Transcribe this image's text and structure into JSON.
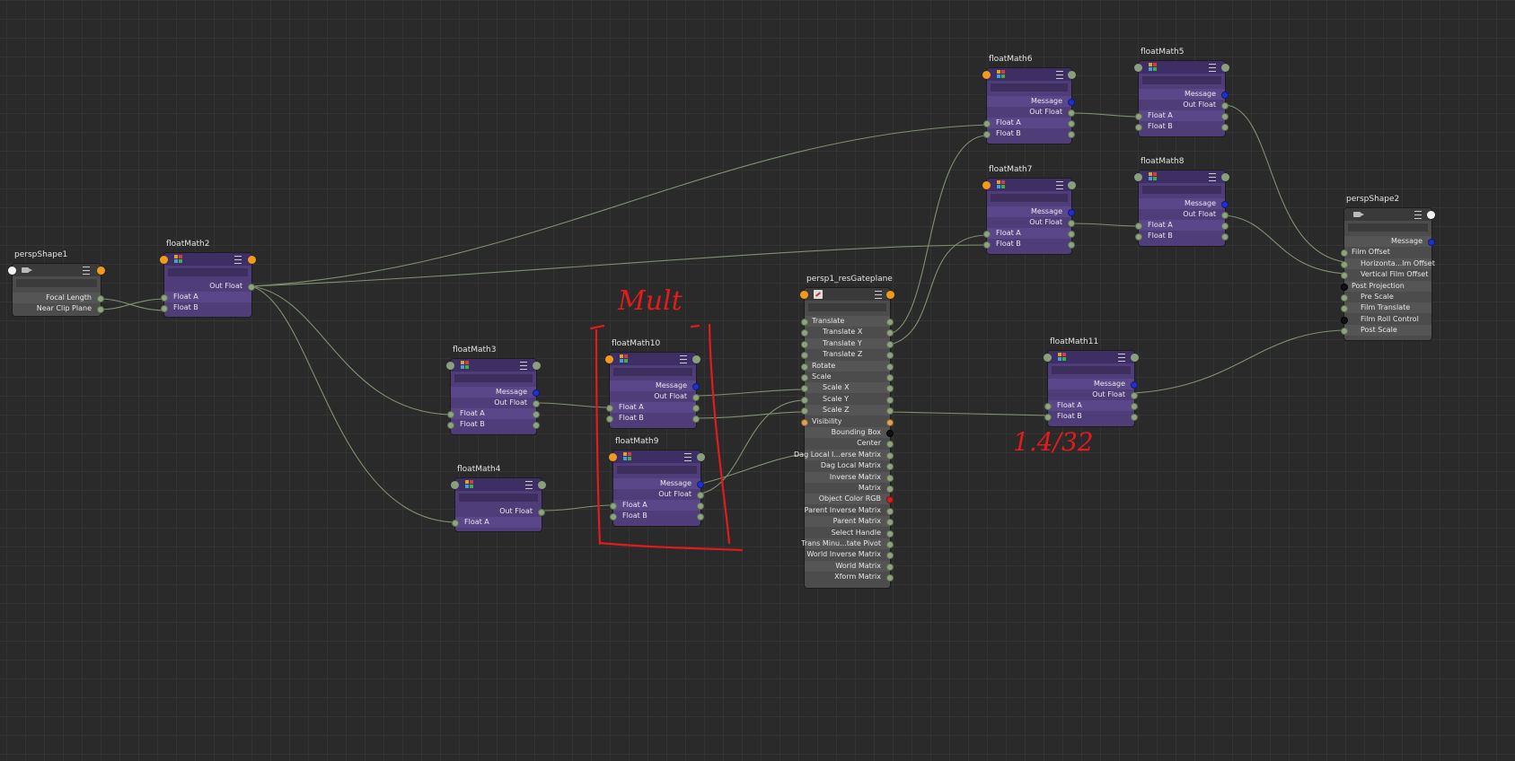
{
  "nodes": {
    "perspShape1": {
      "title": "perspShape1",
      "rows": [
        "Focal Length",
        "Near Clip Plane"
      ]
    },
    "floatMath2": {
      "title": "floatMath2",
      "out": "Out Float",
      "inA": "Float A",
      "inB": "Float B"
    },
    "floatMath3": {
      "title": "floatMath3",
      "msg": "Message",
      "out": "Out Float",
      "inA": "Float A",
      "inB": "Float B"
    },
    "floatMath4": {
      "title": "floatMath4",
      "out": "Out Float",
      "inA": "Float A"
    },
    "floatMath10": {
      "title": "floatMath10",
      "msg": "Message",
      "out": "Out Float",
      "inA": "Float A",
      "inB": "Float B"
    },
    "floatMath9": {
      "title": "floatMath9",
      "msg": "Message",
      "out": "Out Float",
      "inA": "Float A",
      "inB": "Float B"
    },
    "floatMath6": {
      "title": "floatMath6",
      "msg": "Message",
      "out": "Out Float",
      "inA": "Float A",
      "inB": "Float B"
    },
    "floatMath5": {
      "title": "floatMath5",
      "msg": "Message",
      "out": "Out Float",
      "inA": "Float A",
      "inB": "Float B"
    },
    "floatMath7": {
      "title": "floatMath7",
      "msg": "Message",
      "out": "Out Float",
      "inA": "Float A",
      "inB": "Float B"
    },
    "floatMath8": {
      "title": "floatMath8",
      "msg": "Message",
      "out": "Out Float",
      "inA": "Float A",
      "inB": "Float B"
    },
    "floatMath11": {
      "title": "floatMath11",
      "msg": "Message",
      "out": "Out Float",
      "inA": "Float A",
      "inB": "Float B"
    },
    "persp1_resGateplane": {
      "title": "persp1_resGateplane",
      "rows": [
        "Translate",
        "Translate X",
        "Translate Y",
        "Translate Z",
        "Rotate",
        "Scale",
        "Scale X",
        "Scale Y",
        "Scale Z",
        "Visibility",
        "Bounding Box",
        "Center",
        "Dag Local I...erse Matrix",
        "Dag Local Matrix",
        "Inverse Matrix",
        "Matrix",
        "Object Color RGB",
        "Parent Inverse Matrix",
        "Parent Matrix",
        "Select Handle",
        "Trans Minu...tate Pivot",
        "World Inverse Matrix",
        "World Matrix",
        "Xform Matrix"
      ]
    },
    "perspShape2": {
      "title": "perspShape2",
      "rows": [
        "Message",
        "Film Offset",
        "Horizonta...lm Offset",
        "Vertical Film Offset",
        "Post Projection",
        "Pre Scale",
        "Film Translate",
        "Film Roll Control",
        "Post Scale"
      ]
    }
  },
  "annotations": {
    "mult": "Mult",
    "ratio": "1.4/32"
  },
  "colors": {
    "purple_node": "#4f3d7a",
    "gray_node": "#4c4c4c",
    "wire": "#8ea37e",
    "annotation": "#e31b1b"
  }
}
